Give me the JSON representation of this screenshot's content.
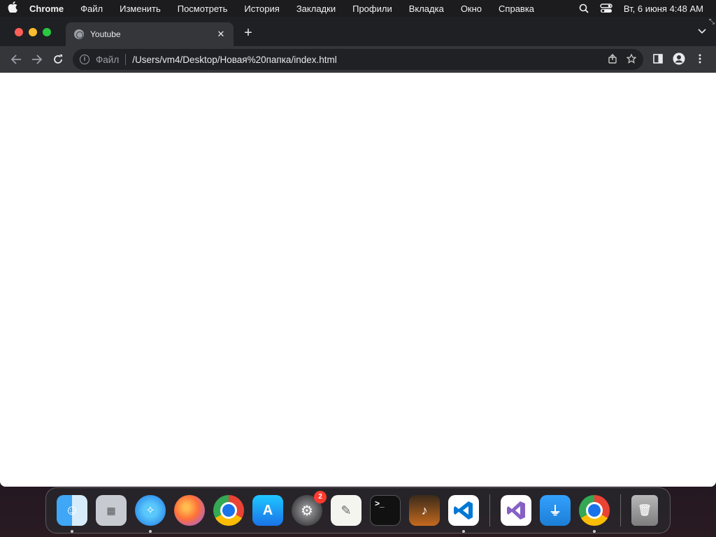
{
  "menubar": {
    "app_name": "Chrome",
    "items": [
      "Файл",
      "Изменить",
      "Посмотреть",
      "История",
      "Закладки",
      "Профили",
      "Вкладка",
      "Окно",
      "Справка"
    ],
    "datetime": "Вт, 6 июня  4:48 AM"
  },
  "browser": {
    "tab": {
      "title": "Youtube"
    },
    "omnibox": {
      "scheme_label": "Файл",
      "url": "/Users/vm4/Desktop/Новая%20папка/index.html"
    }
  },
  "dock": {
    "apps": [
      {
        "name": "finder",
        "running": true
      },
      {
        "name": "launchpad",
        "running": false
      },
      {
        "name": "safari",
        "running": true
      },
      {
        "name": "firefox",
        "running": false
      },
      {
        "name": "chrome",
        "running": false
      },
      {
        "name": "app-store",
        "running": false
      },
      {
        "name": "system-settings",
        "running": false,
        "badge": "2"
      },
      {
        "name": "textedit",
        "running": false
      },
      {
        "name": "terminal",
        "running": false
      },
      {
        "name": "garageband",
        "running": false
      },
      {
        "name": "vscode",
        "running": true
      },
      {
        "name": "visual-studio",
        "running": false
      },
      {
        "name": "keynote",
        "running": false
      },
      {
        "name": "chrome-recent",
        "running": true
      },
      {
        "name": "trash",
        "running": false
      }
    ],
    "settings_badge": "2"
  }
}
